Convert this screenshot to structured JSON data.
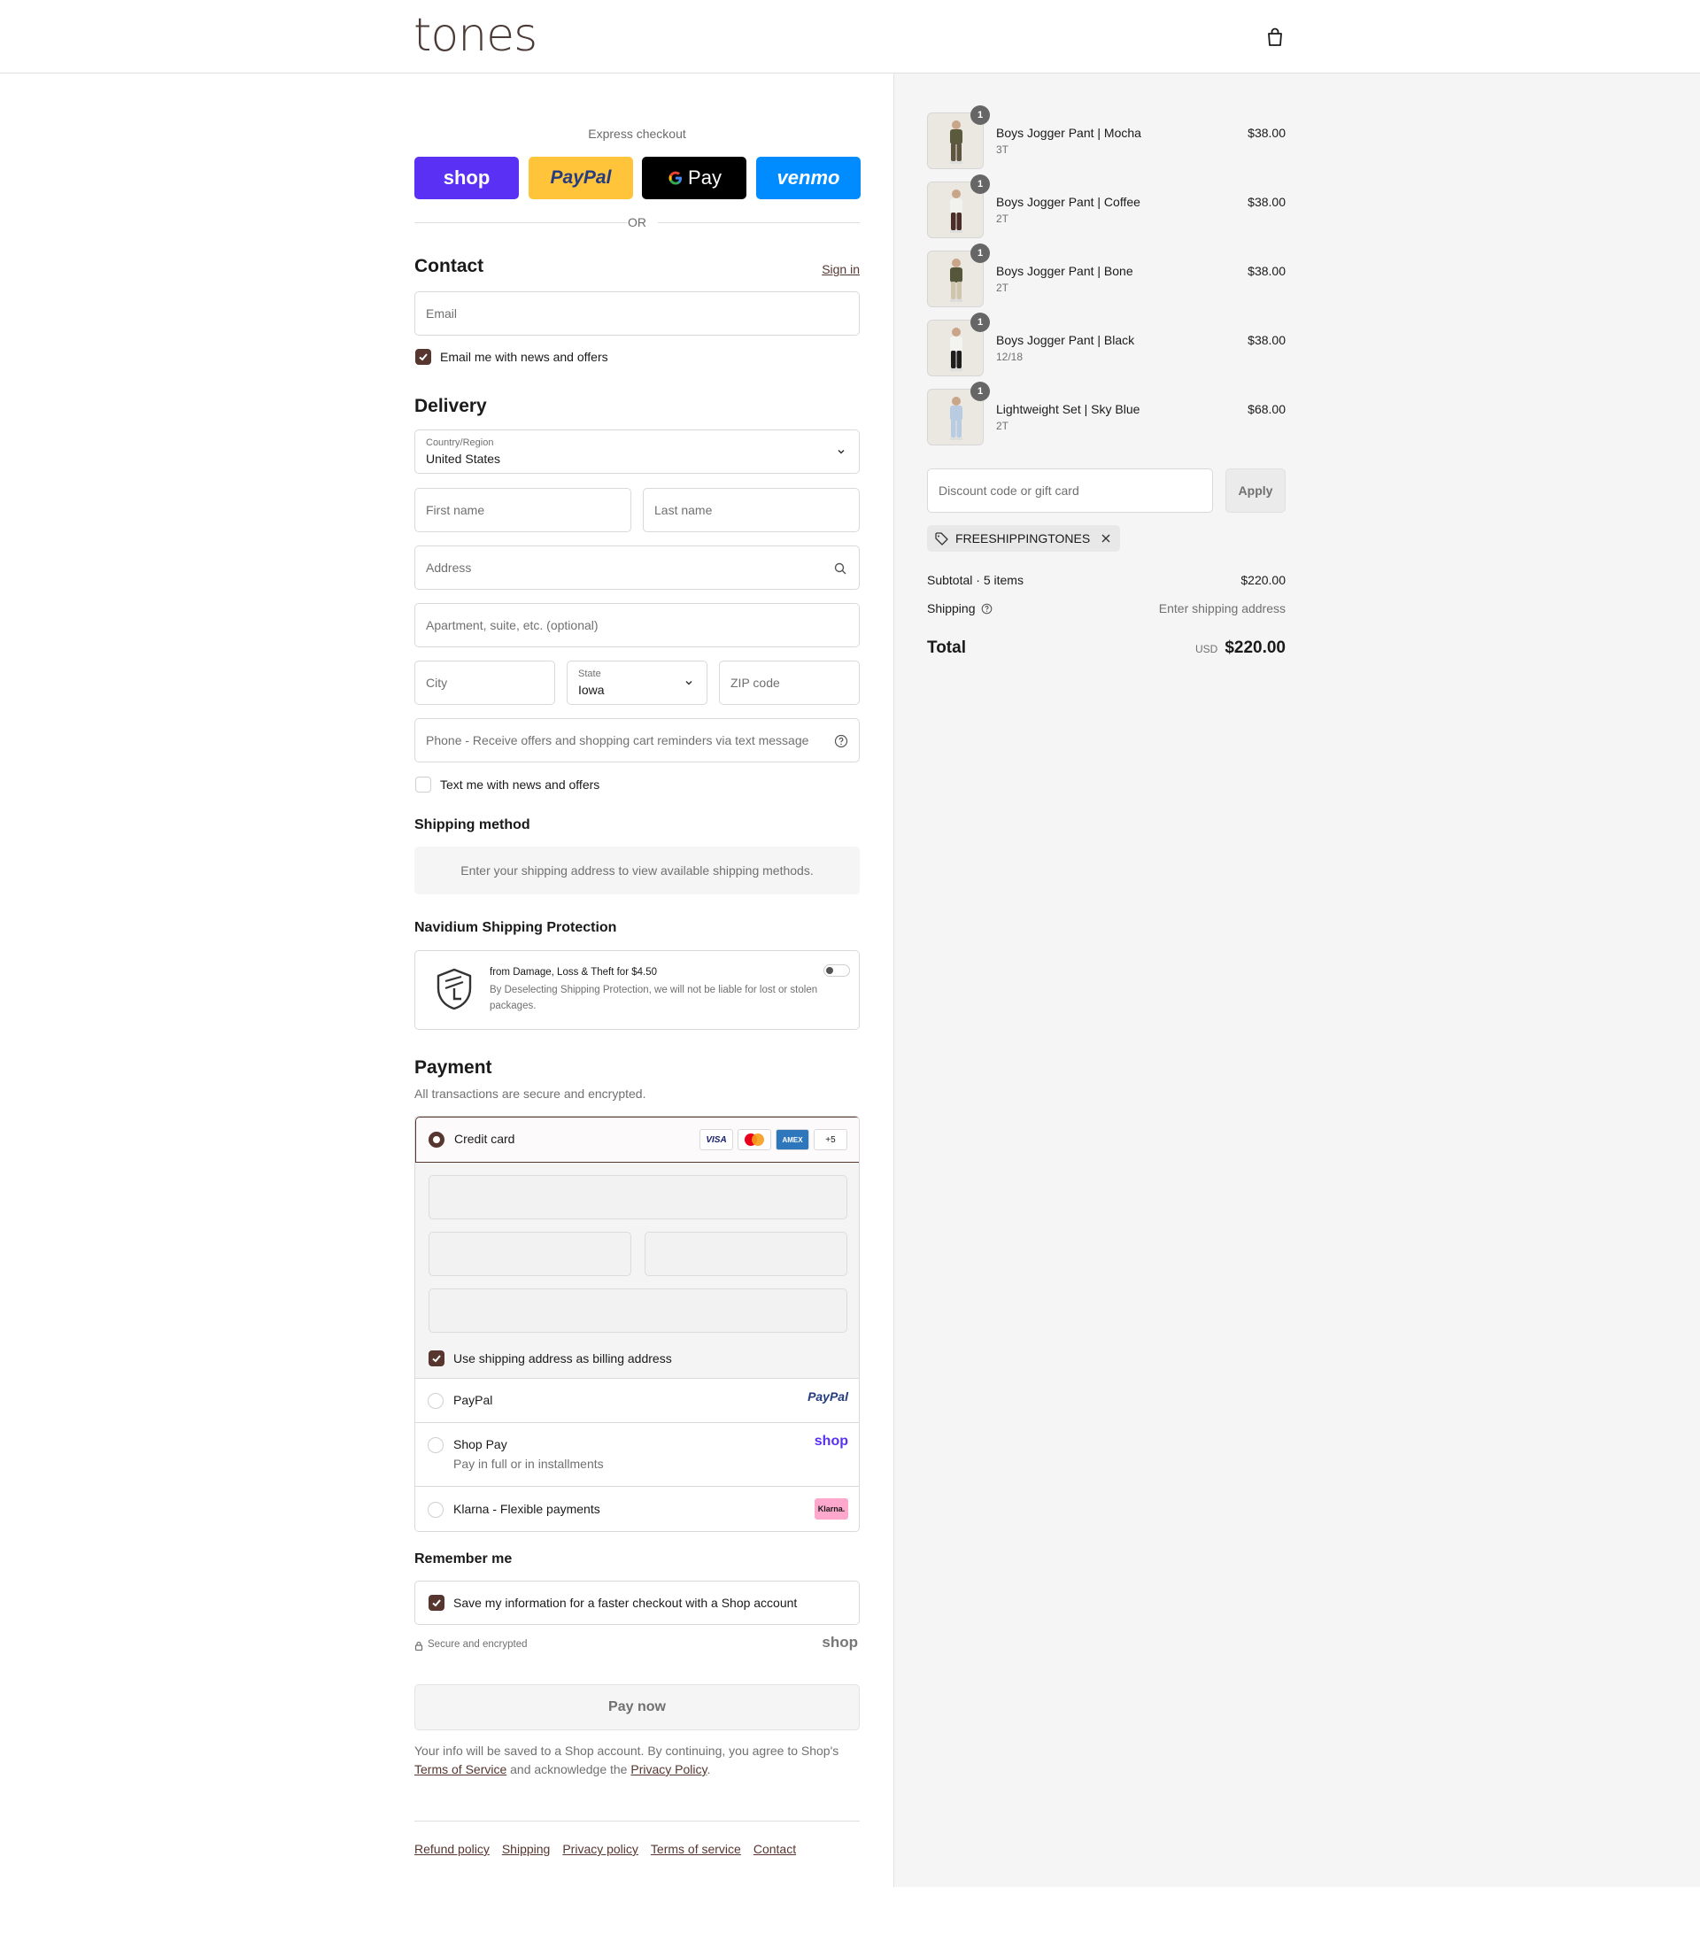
{
  "header": {
    "logo": "tones"
  },
  "express": {
    "title": "Express checkout",
    "buttons": [
      "shop",
      "PayPal",
      "Pay",
      "venmo"
    ],
    "or": "OR"
  },
  "contact": {
    "title": "Contact",
    "sign_in": "Sign in",
    "email_placeholder": "Email",
    "news_label": "Email me with news and offers"
  },
  "delivery": {
    "title": "Delivery",
    "country_label": "Country/Region",
    "country_value": "United States",
    "first_name": "First name",
    "last_name": "Last name",
    "address": "Address",
    "apartment": "Apartment, suite, etc. (optional)",
    "city": "City",
    "state_label": "State",
    "state_value": "Iowa",
    "zip": "ZIP code",
    "phone": "Phone - Receive offers and shopping cart reminders via text message",
    "text_label": "Text me with news and offers"
  },
  "shipping_method": {
    "title": "Shipping method",
    "notice": "Enter your shipping address to view available shipping methods."
  },
  "protection": {
    "title": "Navidium Shipping Protection",
    "headline": "from Damage, Loss & Theft for $4.50",
    "body": "By Deselecting Shipping Protection, we will not be liable for lost or stolen packages."
  },
  "payment": {
    "title": "Payment",
    "subtitle": "All transactions are secure and encrypted.",
    "credit_card": "Credit card",
    "card_badges": [
      "VISA",
      "",
      "AMEX",
      "+5"
    ],
    "billing_label": "Use shipping address as billing address",
    "paypal": "PayPal",
    "paypal_logo": "PayPal",
    "shoppay": "Shop Pay",
    "shoppay_sub": "Pay in full or in installments",
    "shoppay_logo": "shop",
    "klarna": "Klarna - Flexible payments",
    "klarna_logo": "Klarna."
  },
  "remember": {
    "title": "Remember me",
    "save_label": "Save my information for a faster checkout with a Shop account",
    "secure": "Secure and encrypted",
    "shop_logo": "shop"
  },
  "pay_now": "Pay now",
  "legal": {
    "text1": "Your info will be saved to a Shop account. By continuing, you agree to Shop's",
    "tos": "Terms of Service",
    "text2": "and acknowledge the",
    "privacy": "Privacy Policy",
    "text3": "."
  },
  "footer_links": [
    "Refund policy",
    "Shipping",
    "Privacy policy",
    "Terms of service",
    "Contact"
  ],
  "cart": {
    "items": [
      {
        "name": "Boys Jogger Pant | Mocha",
        "variant": "3T",
        "price": "$38.00",
        "qty": "1",
        "top_color": "#5b5a3c",
        "bottom_color": "#5f5440"
      },
      {
        "name": "Boys Jogger Pant | Coffee",
        "variant": "2T",
        "price": "$38.00",
        "qty": "1",
        "top_color": "#f1f1ee",
        "bottom_color": "#4a2e27"
      },
      {
        "name": "Boys Jogger Pant | Bone",
        "variant": "2T",
        "price": "$38.00",
        "qty": "1",
        "top_color": "#55573a",
        "bottom_color": "#cfc4ad"
      },
      {
        "name": "Boys Jogger Pant | Black",
        "variant": "12/18",
        "price": "$38.00",
        "qty": "1",
        "top_color": "#f3f3f0",
        "bottom_color": "#1e1e1e"
      },
      {
        "name": "Lightweight Set | Sky Blue",
        "variant": "2T",
        "price": "$68.00",
        "qty": "1",
        "top_color": "#b8cbe0",
        "bottom_color": "#b8cbe0"
      }
    ],
    "discount_placeholder": "Discount code or gift card",
    "apply": "Apply",
    "code": "FREESHIPPINGTONES",
    "subtotal_label": "Subtotal · 5 items",
    "subtotal_value": "$220.00",
    "shipping_label": "Shipping",
    "shipping_value": "Enter shipping address",
    "total_label": "Total",
    "currency": "USD",
    "total_value": "$220.00"
  },
  "colors": {
    "accent": "#56362f",
    "shop": "#5a31f4",
    "paypal": "#ffc439",
    "venmo": "#008cff"
  }
}
